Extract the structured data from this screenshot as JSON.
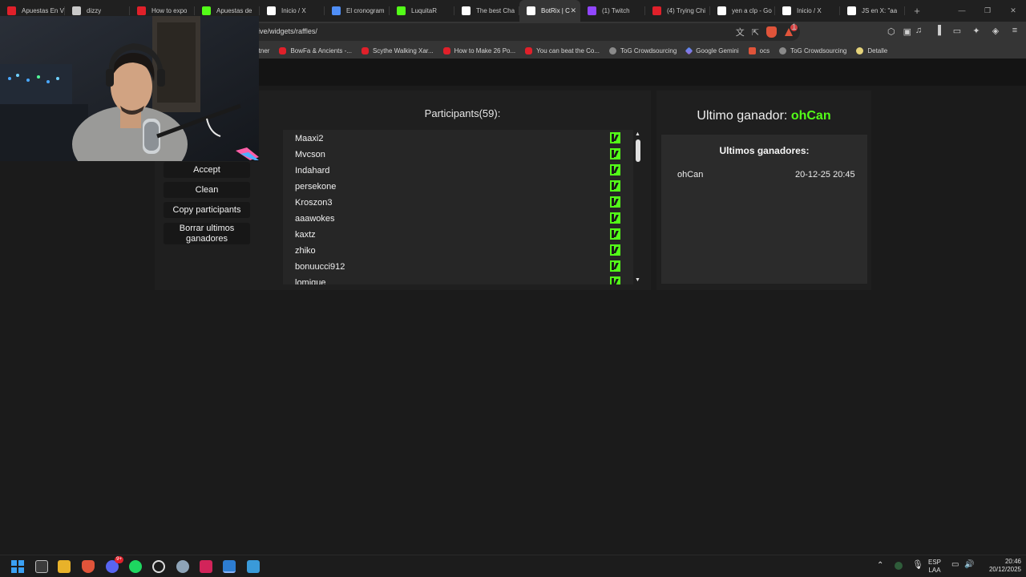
{
  "browser": {
    "tabs": [
      {
        "label": "Apuestas En V",
        "icon": "kick-tab-icon",
        "color": "#e0202a"
      },
      {
        "label": "dizzy",
        "icon": "chatgpt-tab-icon",
        "color": "#c9c9c9"
      },
      {
        "label": "How to expo",
        "icon": "youtube-tab-icon",
        "color": "#e0202a"
      },
      {
        "label": "Apuestas de",
        "icon": "kick-tab-icon",
        "color": "#53fc18"
      },
      {
        "label": "Inicio / X",
        "icon": "x-tab-icon",
        "color": "#ffffff"
      },
      {
        "label": "El cronogram",
        "icon": "edge-tab-icon",
        "color": "#4f8ef7"
      },
      {
        "label": "LuquitaR",
        "icon": "kick-tab-icon",
        "color": "#53fc18"
      },
      {
        "label": "The best Cha",
        "icon": "botrix-tab-icon",
        "color": "#ffffff"
      },
      {
        "label": "BotRix | C",
        "icon": "botrix-tab-icon",
        "color": "#ffffff",
        "active": true
      },
      {
        "label": "(1) Twitch",
        "icon": "twitch-tab-icon",
        "color": "#9146ff"
      },
      {
        "label": "(4) Trying Chi",
        "icon": "youtube-tab-icon",
        "color": "#e0202a"
      },
      {
        "label": "yen a clp - Go",
        "icon": "google-tab-icon",
        "color": "#ffffff"
      },
      {
        "label": "Inicio / X",
        "icon": "x-tab-icon",
        "color": "#ffffff"
      },
      {
        "label": "JS en X: \"aa",
        "icon": "x-tab-icon",
        "color": "#ffffff"
      }
    ],
    "tab_close": "✕",
    "new_tab": "+",
    "url": "ive/widgets/raffles/",
    "rewards_badge": "1"
  },
  "bookmarks": [
    {
      "label": "rtner",
      "icon": "none"
    },
    {
      "label": "BowFa & Ancients -...",
      "icon": "yt"
    },
    {
      "label": "Scythe Walking Xar...",
      "icon": "yt"
    },
    {
      "label": "How to Make 26 Po...",
      "icon": "yt"
    },
    {
      "label": "You can beat the Co...",
      "icon": "yt"
    },
    {
      "label": "ToG Crowdsourcing",
      "icon": "gray"
    },
    {
      "label": "Google Gemini",
      "icon": "gem"
    },
    {
      "label": "ocs",
      "icon": "brave"
    },
    {
      "label": "ToG Crowdsourcing",
      "icon": "gray"
    },
    {
      "label": "Detalle",
      "icon": "yel"
    }
  ],
  "raffle": {
    "buttons": [
      "Accept",
      "Clean",
      "Copy participants",
      "Borrar ultimos ganadores"
    ],
    "participants_title": "Participants(59):",
    "participants": [
      "Maaxi2",
      "Mvcson",
      "Indahard",
      "persekone",
      "Kroszon3",
      "aaawokes",
      "kaxtz",
      "zhiko",
      "bonuucci912",
      "lomique"
    ],
    "last_winner_label": "Ultimo ganador:",
    "last_winner": "ohCan",
    "winners_header": "Ultimos ganadores:",
    "winners": [
      {
        "name": "ohCan",
        "date": "20-12-25 20:45"
      }
    ]
  },
  "taskbar": {
    "lang": "ESP",
    "layout": "LAA",
    "time": "20:46",
    "date": "20/12/2025",
    "discord_badge": "9+"
  }
}
